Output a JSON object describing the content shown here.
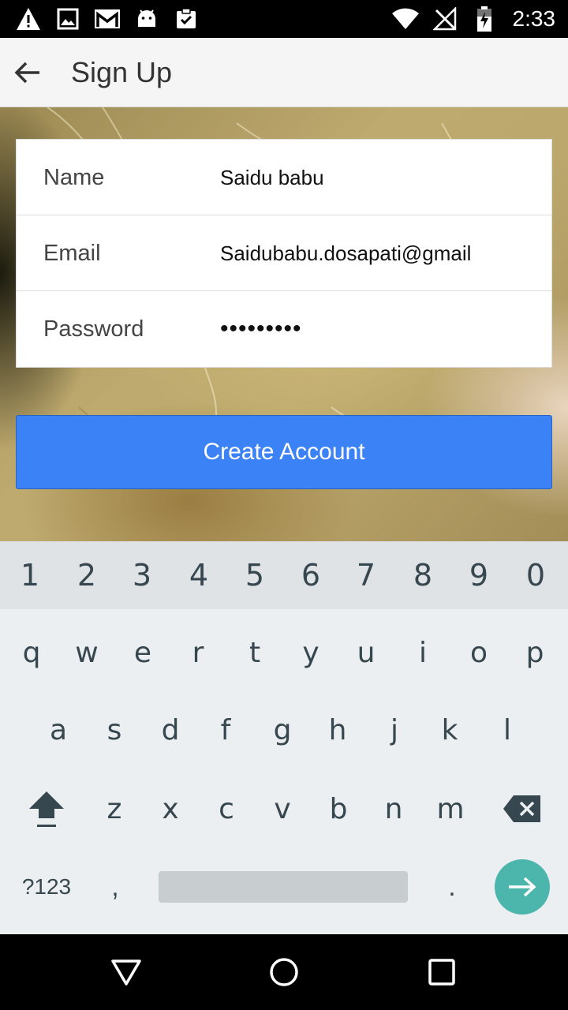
{
  "status_bar": {
    "time": "2:33",
    "icons": [
      "warning-icon",
      "image-icon",
      "gmail-icon",
      "android-icon",
      "clipboard-check-icon",
      "wifi-icon",
      "no-signal-icon",
      "battery-charging-icon"
    ]
  },
  "app_bar": {
    "title": "Sign Up",
    "back_icon": "arrow-back-icon"
  },
  "form": {
    "fields": [
      {
        "label": "Name",
        "value": "Saidu babu"
      },
      {
        "label": "Email",
        "value": "Saidubabu.dosapati@gmail"
      },
      {
        "label": "Password",
        "value": "•••••••••"
      }
    ],
    "submit_label": "Create Account"
  },
  "keyboard": {
    "number_row": [
      "1",
      "2",
      "3",
      "4",
      "5",
      "6",
      "7",
      "8",
      "9",
      "0"
    ],
    "row1": [
      "q",
      "w",
      "e",
      "r",
      "t",
      "y",
      "u",
      "i",
      "o",
      "p"
    ],
    "row2": [
      "a",
      "s",
      "d",
      "f",
      "g",
      "h",
      "j",
      "k",
      "l"
    ],
    "row3": [
      "z",
      "x",
      "c",
      "v",
      "b",
      "n",
      "m"
    ],
    "symbols_label": "?123",
    "comma": ",",
    "period": "."
  },
  "nav_bar": {
    "buttons": [
      "back-triangle-icon",
      "home-circle-icon",
      "recents-square-icon"
    ]
  },
  "colors": {
    "primary_button": "#3b82f6",
    "enter_key": "#4db6ac",
    "keyboard_bg": "#eceff1"
  }
}
